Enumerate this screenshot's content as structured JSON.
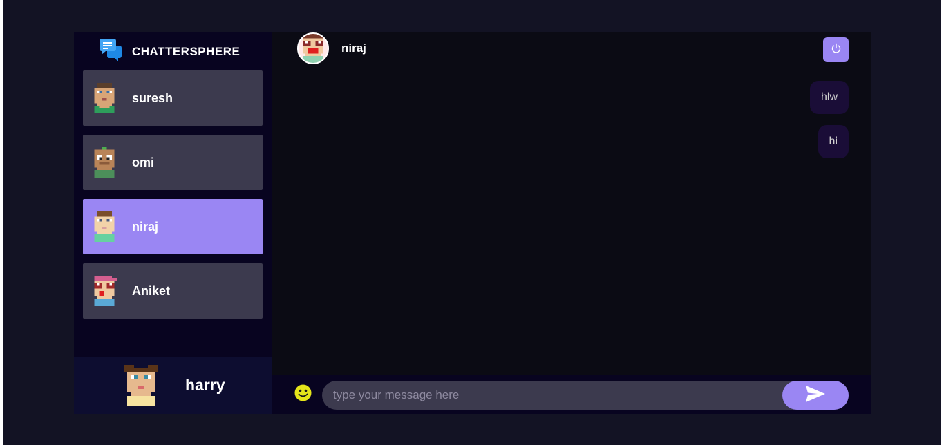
{
  "brand": {
    "title": "CHATTERSPHERE",
    "icon": "chat-bubbles-icon"
  },
  "contacts": [
    {
      "name": "suresh",
      "avatar": "pixel-avatar-suresh-icon",
      "selected": false
    },
    {
      "name": "omi",
      "avatar": "pixel-avatar-omi-icon",
      "selected": false
    },
    {
      "name": "niraj",
      "avatar": "pixel-avatar-niraj-icon",
      "selected": true
    },
    {
      "name": "Aniket",
      "avatar": "pixel-avatar-aniket-icon",
      "selected": false
    }
  ],
  "current_user": {
    "name": "harry",
    "avatar": "pixel-avatar-harry-icon"
  },
  "chat": {
    "header_name": "niraj",
    "logout_icon": "power-icon",
    "messages": [
      {
        "text": "hlw",
        "sent": true
      },
      {
        "text": "hi",
        "sent": true
      }
    ]
  },
  "input": {
    "placeholder": "type your message here",
    "value": "",
    "emoji_icon": "smiley-icon",
    "send_icon": "send-arrow-icon"
  },
  "colors": {
    "accent": "#9a86f3",
    "contact_bg": "#3c3a4e",
    "sidebar_bg": "#080420",
    "bubble_bg": "#1a0d37"
  }
}
